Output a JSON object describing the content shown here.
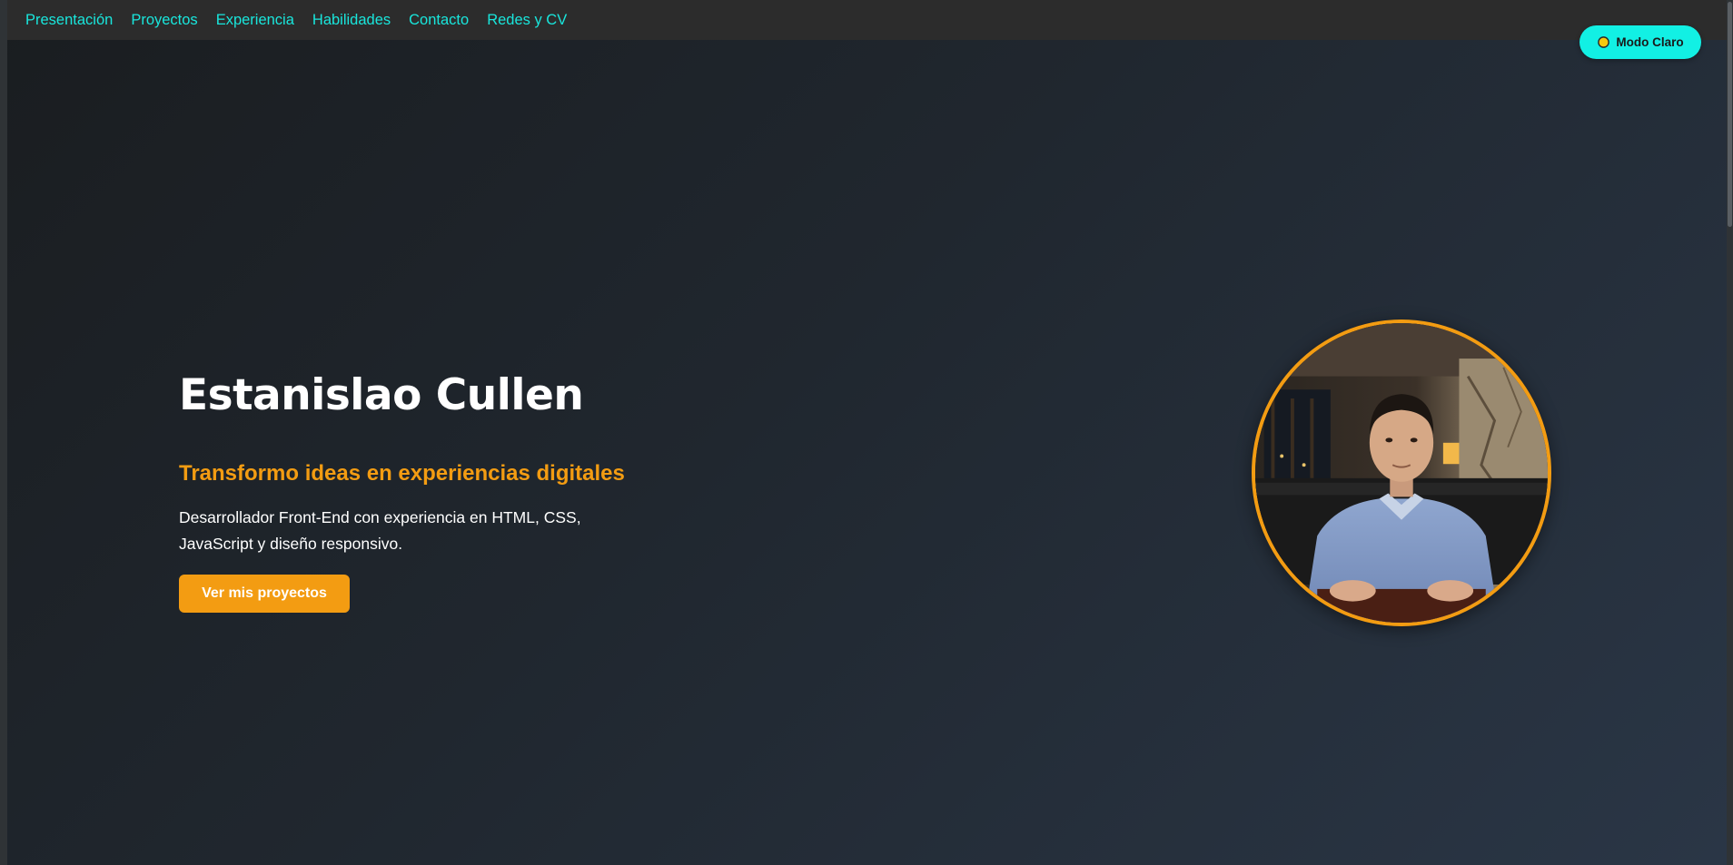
{
  "nav": {
    "links": [
      {
        "label": "Presentación"
      },
      {
        "label": "Proyectos"
      },
      {
        "label": "Experiencia"
      },
      {
        "label": "Habilidades"
      },
      {
        "label": "Contacto"
      },
      {
        "label": "Redes y CV"
      }
    ]
  },
  "theme_toggle": {
    "label": "Modo Claro",
    "icon": "sun-icon",
    "color": "#12f0e4"
  },
  "hero": {
    "name": "Estanislao Cullen",
    "tagline": "Transformo ideas en experiencias digitales",
    "description": "Desarrollador Front-End con experiencia en HTML, CSS, JavaScript y diseño responsivo.",
    "cta_label": "Ver mis proyectos",
    "accent_color": "#f39c12",
    "nav_link_color": "#19e6dc"
  },
  "avatar": {
    "icon": "profile-photo"
  }
}
